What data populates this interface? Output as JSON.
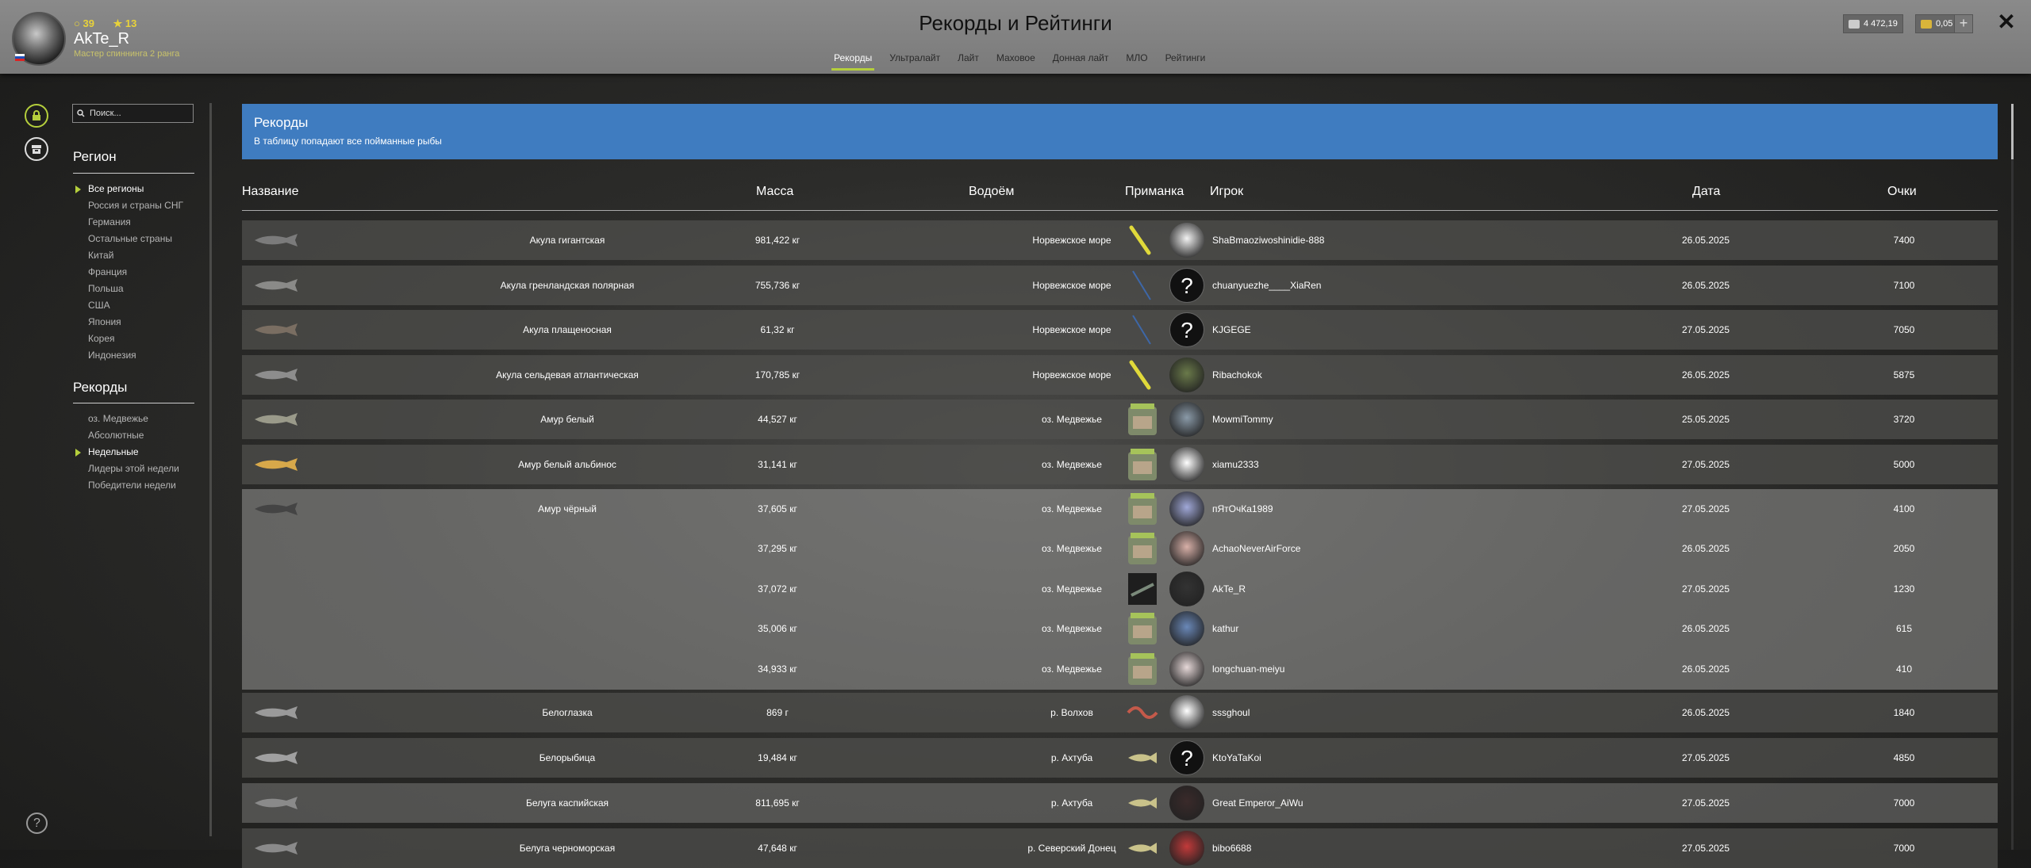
{
  "player": {
    "name": "AkTe_R",
    "rank": "Мастер спиннинга 2 ранга",
    "level": "39",
    "stars": "13"
  },
  "page_title": "Рекорды и Рейтинги",
  "tabs": [
    "Рекорды",
    "Ультралайт",
    "Лайт",
    "Маховое",
    "Донная лайт",
    "МЛО",
    "Рейтинги"
  ],
  "currency": {
    "silver": "4 472,19",
    "gold": "0,05"
  },
  "search": {
    "placeholder": "Поиск..."
  },
  "sidebar": {
    "region_title": "Регион",
    "regions": [
      "Все регионы",
      "Россия и страны СНГ",
      "Германия",
      "Остальные страны",
      "Китай",
      "Франция",
      "Польша",
      "США",
      "Япония",
      "Корея",
      "Индонезия"
    ],
    "records_title": "Рекорды",
    "records": [
      "оз. Медвежье",
      "Абсолютные",
      "Недельные",
      "Лидеры этой недели",
      "Победители недели"
    ]
  },
  "banner": {
    "title": "Рекорды",
    "subtitle": "В таблицу попадают все пойманные рыбы"
  },
  "table": {
    "headers": {
      "name": "Название",
      "mass": "Масса",
      "water": "Водоём",
      "bait": "Приманка",
      "player": "Игрок",
      "date": "Дата",
      "points": "Очки"
    },
    "rows": [
      {
        "name": "Акула гигантская",
        "mass": "981,422 кг",
        "water": "Норвежское море",
        "player": "ShaBmaoziwoshinidie-888",
        "date": "26.05.2025",
        "points": "7400"
      },
      {
        "name": "Акула гренландская полярная",
        "mass": "755,736 кг",
        "water": "Норвежское море",
        "player": "chuanyuezhe____XiaRen",
        "date": "26.05.2025",
        "points": "7100"
      },
      {
        "name": "Акула плащеносная",
        "mass": "61,32 кг",
        "water": "Норвежское море",
        "player": "KJGEGE",
        "date": "27.05.2025",
        "points": "7050"
      },
      {
        "name": "Акула сельдевая атлантическая",
        "mass": "170,785 кг",
        "water": "Норвежское море",
        "player": "Ribachokok",
        "date": "26.05.2025",
        "points": "5875"
      },
      {
        "name": "Амур белый",
        "mass": "44,527 кг",
        "water": "оз. Медвежье",
        "player": "MowmiTommy",
        "date": "25.05.2025",
        "points": "3720"
      },
      {
        "name": "Амур белый альбинос",
        "mass": "31,141 кг",
        "water": "оз. Медвежье",
        "player": "xiamu2333",
        "date": "27.05.2025",
        "points": "5000"
      },
      {
        "name": "Амур чёрный",
        "mass": "37,605 кг",
        "water": "оз. Медвежье",
        "player": "пЯтОчКа1989",
        "date": "27.05.2025",
        "points": "4100"
      },
      {
        "name": "",
        "mass": "37,295 кг",
        "water": "оз. Медвежье",
        "player": "AchaoNeverAirForce",
        "date": "26.05.2025",
        "points": "2050"
      },
      {
        "name": "",
        "mass": "37,072 кг",
        "water": "оз. Медвежье",
        "player": "AkTe_R",
        "date": "27.05.2025",
        "points": "1230"
      },
      {
        "name": "",
        "mass": "35,006 кг",
        "water": "оз. Медвежье",
        "player": "kathur",
        "date": "26.05.2025",
        "points": "615"
      },
      {
        "name": "",
        "mass": "34,933 кг",
        "water": "оз. Медвежье",
        "player": "longchuan-meiyu",
        "date": "26.05.2025",
        "points": "410"
      },
      {
        "name": "Белоглазка",
        "mass": "869 г",
        "water": "р. Волхов",
        "player": "sssghoul",
        "date": "26.05.2025",
        "points": "1840"
      },
      {
        "name": "Белорыбица",
        "mass": "19,484 кг",
        "water": "р. Ахтуба",
        "player": "KtoYaTaKoi",
        "date": "27.05.2025",
        "points": "4850"
      },
      {
        "name": "Белуга каспийская",
        "mass": "811,695 кг",
        "water": "р. Ахтуба",
        "player": "Great Emperor_AiWu",
        "date": "27.05.2025",
        "points": "7000"
      },
      {
        "name": "Белуга черноморская",
        "mass": "47,648 кг",
        "water": "р. Северский Донец",
        "player": "bibo6688",
        "date": "27.05.2025",
        "points": "7000"
      }
    ]
  },
  "colors": {
    "accent": "#b5cf3c",
    "banner": "#3f7cc0",
    "header_bg": "#808080"
  }
}
